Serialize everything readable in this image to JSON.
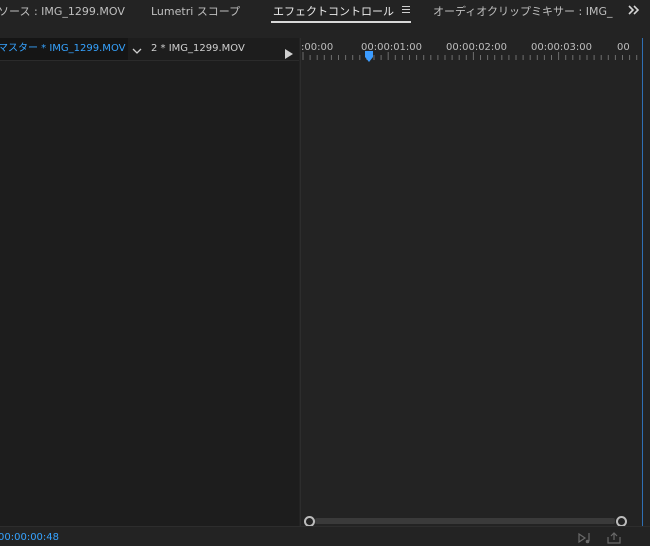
{
  "tabs": [
    {
      "label": "ソース : IMG_1299.MOV",
      "active": false
    },
    {
      "label": "Lumetri スコープ",
      "active": false
    },
    {
      "label": "エフェクトコントロール",
      "active": true
    },
    {
      "label": "オーディオクリップミキサー : IMG_",
      "active": false
    }
  ],
  "clip_header": {
    "master_clip": "マスター * IMG_1299.MOV",
    "sequence_clip": "2 * IMG_1299.MOV"
  },
  "ruler": {
    "labels": [
      ":00:00",
      "00:00:01:00",
      "00:00:02:00",
      "00:00:03:00",
      "00"
    ]
  },
  "status": {
    "timecode": "00:00:00:48"
  },
  "colors": {
    "accent": "#36a3ff",
    "background": "#232323",
    "panel_dark": "#1d1d1d",
    "text": "#bdbdbd"
  },
  "icons": {
    "tab_menu": "hamburger-menu-icon",
    "overflow": "chevron-double-right-icon",
    "dropdown": "chevron-down-icon",
    "play": "play-icon",
    "playhead": "playhead-icon",
    "filter": "filter-audio-icon",
    "export": "export-icon"
  }
}
